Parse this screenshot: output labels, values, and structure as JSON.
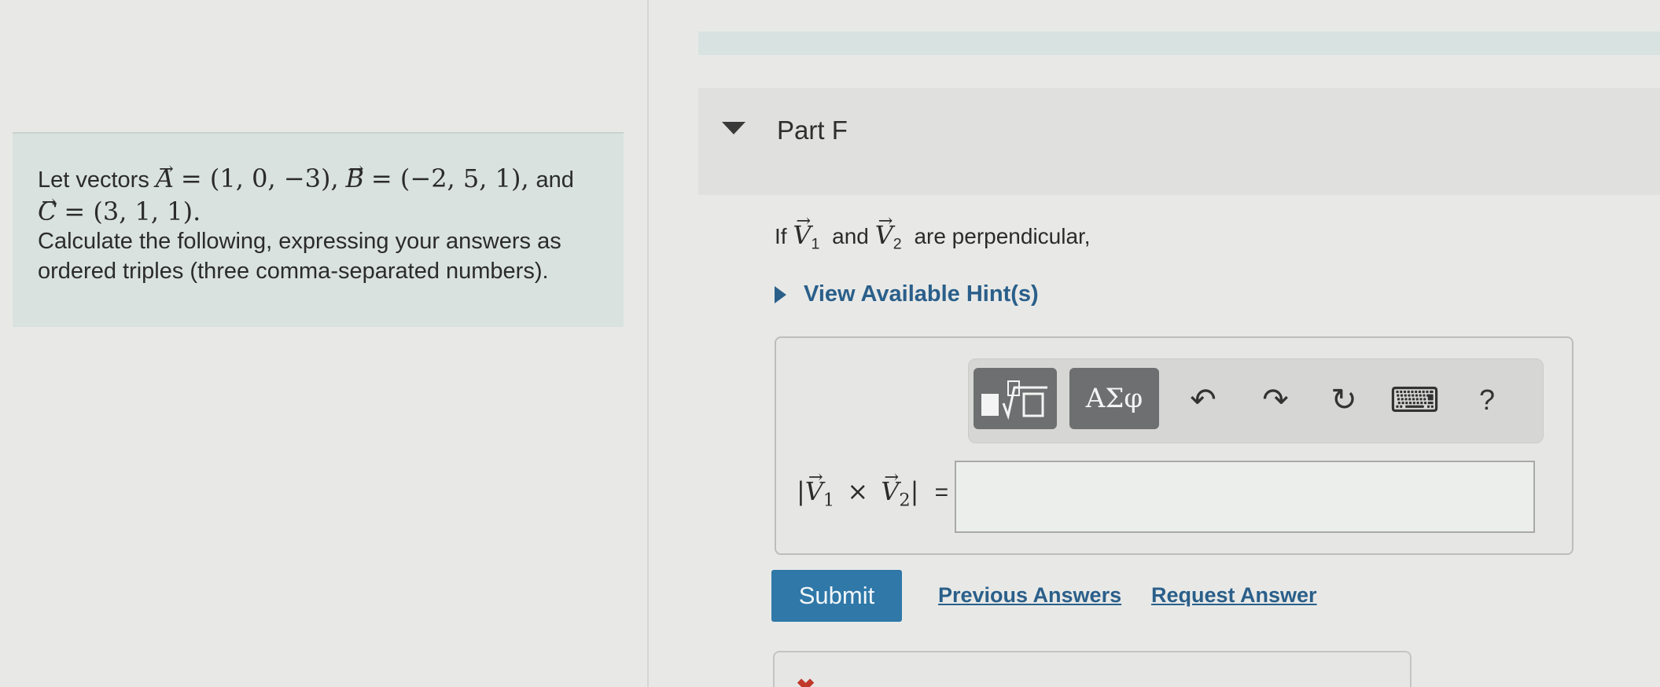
{
  "problem": {
    "intro": "Let vectors",
    "vecA_name": "A",
    "vecA_value": "= (1, 0, −3),",
    "vecB_name": "B",
    "vecB_value": "= (−2, 5, 1),",
    "and_text": "and",
    "vecC_name": "C",
    "vecC_value": "= (3, 1, 1).",
    "instruction_line1": "Calculate the following, expressing your answers as",
    "instruction_line2": "ordered triples (three comma-separated numbers)."
  },
  "part": {
    "title": "Part F",
    "question_if": "If",
    "v1": "V",
    "v1_sub": "1",
    "and_text": "and",
    "v2": "V",
    "v2_sub": "2",
    "question_rest": "are perpendicular,",
    "hints_label": "View Available Hint(s)"
  },
  "toolbar": {
    "templates_label": "▮√▯",
    "symbols_label": "ΑΣφ",
    "undo": "↶",
    "redo": "↷",
    "reset": "↻",
    "keyboard": "⌨",
    "help": "?"
  },
  "equation": {
    "bar_open": "|",
    "v1": "V",
    "v1_sub": "1",
    "times": "×",
    "v2": "V",
    "v2_sub": "2",
    "bar_close": "|",
    "equals": "=",
    "input_value": ""
  },
  "actions": {
    "submit": "Submit",
    "previous_answers": "Previous Answers",
    "request_answer": "Request Answer"
  },
  "feedback": {
    "status_icon": "✖"
  }
}
